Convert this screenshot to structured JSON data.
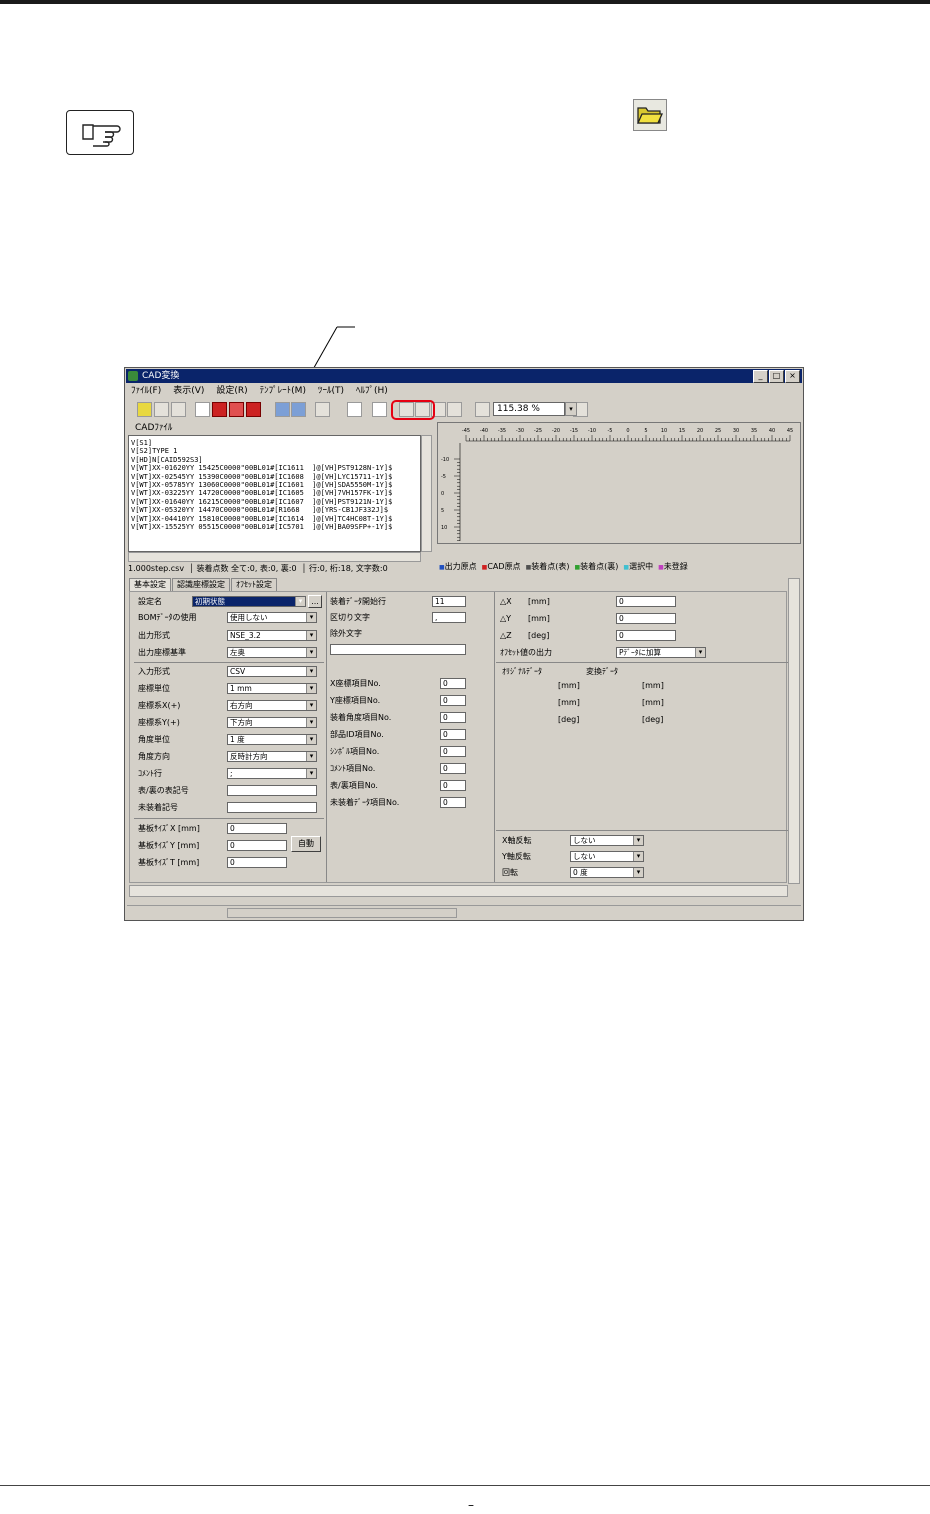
{
  "window": {
    "title": "CAD変換",
    "minimize": "_",
    "maximize": "□",
    "close": "×"
  },
  "menu": [
    "ﾌｧｲﾙ(F)",
    "表示(V)",
    "設定(R)",
    "ﾃﾝﾌﾟﾚｰﾄ(M)",
    "ﾂｰﾙ(T)",
    "ﾍﾙﾌﾟ(H)"
  ],
  "toolbar": {
    "zoom_value": "115.38 %"
  },
  "cad_panel": {
    "label": "CADﾌｧｲﾙ",
    "lines": [
      "V[S1]",
      "V[S2]TYPE 1",
      "V[HD]N[CAID592S3]",
      "V[WT]XX-01620YY 15425C0000\"00BL01#[IC1611  ]@[VH]PST9128N-1Y]$",
      "V[WT]XX-02545YY 15390C0000\"00BL01#[IC1608  ]@[VH]LYC15711-1Y]$",
      "V[WT]XX-05785YY 13060C0000\"00BL01#[IC1601  ]@[VH]SDA5550M-1Y]$",
      "V[WT]XX-03225YY 14720C0000\"00BL01#[IC1605  ]@[VH]7VH157FK-1Y]$",
      "V[WT]XX-01640YY 16215C0000\"00BL01#[IC1607  ]@[VH]PST9121N-1Y]$",
      "V[WT]XX-05320YY 14470C0000\"00BL01#[R1668   ]@[YRS-CB1JF332J]$",
      "V[WT]XX-04410YY 15810C0000\"00BL01#[IC1614  ]@[VH]TC4HC08T-1Y]$",
      "V[WT]XX-15525YY 05515C0000\"00BL01#[IC5701  ]@[VH]BA09SFP+-1Y]$"
    ],
    "status_file": "1.000step.csv",
    "status_count": "装着点数 全て:0, 表:0, 裏:0",
    "status_pos": "行:0, 桁:18, 文字数:0"
  },
  "legend": [
    {
      "label": "出力原点",
      "color": "#2050c0"
    },
    {
      "label": "CAD原点",
      "color": "#d02020"
    },
    {
      "label": "装着点(表)",
      "color": "#505050"
    },
    {
      "label": "装着点(裏)",
      "color": "#30a030"
    },
    {
      "label": "選択中",
      "color": "#40c0d0"
    },
    {
      "label": "未登録",
      "color": "#c040c0"
    }
  ],
  "ruler": {
    "h_ticks": [
      "-45",
      "-40",
      "-35",
      "-30",
      "-25",
      "-20",
      "-15",
      "-10",
      "-5",
      "0",
      "5",
      "10",
      "15",
      "20",
      "25",
      "30",
      "35",
      "40",
      "45"
    ],
    "v_ticks": [
      "-10",
      "-5",
      "0",
      "5",
      "10"
    ]
  },
  "tabs": [
    "基本設定",
    "認識座標設定",
    "ｵﾌｾｯﾄ設定"
  ],
  "form": {
    "setting_name_label": "設定名",
    "setting_name_value": "初期状態",
    "browse": "...",
    "bom_label": "BOMﾃﾞｰﾀの使用",
    "bom_value": "使用しない",
    "output_format_label": "出力形式",
    "output_format_value": "NSE_3.2",
    "output_coord_label": "出力座標基準",
    "output_coord_value": "左奥",
    "input_format_label": "入力形式",
    "input_format_value": "CSV",
    "coord_unit_label": "座標単位",
    "coord_unit_value": "1 mm",
    "coord_x_label": "座標系X(+)",
    "coord_x_value": "右方向",
    "coord_y_label": "座標系Y(+)",
    "coord_y_value": "下方向",
    "angle_unit_label": "角度単位",
    "angle_unit_value": "1 度",
    "angle_dir_label": "角度方向",
    "angle_dir_value": "反時計方向",
    "comment_label": "ｺﾒﾝﾄ行",
    "comment_value": ";",
    "front_back_label": "表/裏の表記号",
    "front_back_value": "",
    "unmounted_label": "未装着記号",
    "unmounted_value": "",
    "board_x_label": "基板ｻｲｽﾞX [mm]",
    "board_x_value": "0",
    "board_y_label": "基板ｻｲｽﾞY [mm]",
    "board_y_value": "0",
    "board_t_label": "基板ｻｲｽﾞT [mm]",
    "board_t_value": "0",
    "auto_button": "自動",
    "start_line_label": "装着ﾃﾞｰﾀ開始行",
    "start_line_value": "11",
    "delimiter_label": "区切り文字",
    "delimiter_value": ",",
    "exclude_label": "除外文字",
    "exclude_value": "",
    "x_item_label": "X座標項目No.",
    "x_item_value": "0",
    "y_item_label": "Y座標項目No.",
    "y_item_value": "0",
    "angle_item_label": "装着角度項目No.",
    "angle_item_value": "0",
    "part_id_label": "部品ID項目No.",
    "part_id_value": "0",
    "symbol_label": "ｼﾝﾎﾞﾙ項目No.",
    "symbol_value": "0",
    "comment_item_label": "ｺﾒﾝﾄ項目No.",
    "comment_item_value": "0",
    "fb_item_label": "表/裏項目No.",
    "fb_item_value": "0",
    "unmounted_item_label": "未装着ﾃﾞｰﾀ項目No.",
    "unmounted_item_value": "0",
    "dx_label": "△X",
    "dx_unit": "[mm]",
    "dx_value": "0",
    "dy_label": "△Y",
    "dy_unit": "[mm]",
    "dy_value": "0",
    "dz_label": "△Z",
    "dz_unit": "[deg]",
    "dz_value": "0",
    "offset_out_label": "ｵﾌｾｯﾄ値の出力",
    "offset_out_value": "Pﾃﾞｰﾀに加算",
    "original_label": "ｵﾘｼﾞﾅﾙﾃﾞｰﾀ",
    "converted_label": "変換ﾃﾞｰﾀ",
    "unit_mm": "[mm]",
    "unit_deg": "[deg]",
    "x_flip_label": "X軸反転",
    "x_flip_value": "しない",
    "y_flip_label": "Y軸反転",
    "y_flip_value": "しない",
    "rotate_label": "回転",
    "rotate_value": "0 度"
  },
  "page_mark": "–"
}
